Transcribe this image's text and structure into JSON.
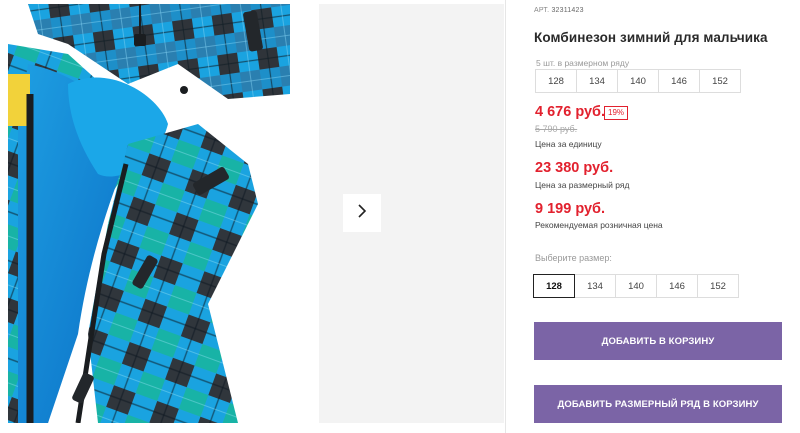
{
  "gallery": {
    "next_icon": "chevron-right-icon"
  },
  "product": {
    "art_label": "АРТ.",
    "art_number": "32311423",
    "title": "Комбинезон зимний для мальчика"
  },
  "set": {
    "note": "5 шт. в размерном ряду",
    "sizes": [
      "128",
      "134",
      "140",
      "146",
      "152"
    ]
  },
  "pricing": {
    "unit_price": "4 676 руб.",
    "discount": "19%",
    "old_price": "5 790 руб.",
    "unit_label": "Цена за единицу",
    "set_price": "23 380 руб.",
    "set_label": "Цена за размерный ряд",
    "rrp_price": "9 199 руб.",
    "rrp_label": "Рекомендуемая розничная цена"
  },
  "size_picker": {
    "label": "Выберите размер:",
    "options": [
      "128",
      "134",
      "140",
      "146",
      "152"
    ],
    "selected": "128"
  },
  "actions": {
    "add_to_cart": "ДОБАВИТЬ В КОРЗИНУ",
    "add_set_to_cart": "ДОБАВИТЬ РАЗМЕРНЫЙ РЯД В КОРЗИНУ"
  },
  "colors": {
    "accent_price": "#e2212e",
    "button_purple": "#7b64a6",
    "jacket_blue": "#1aa3e0",
    "jacket_dark": "#2f343a",
    "jacket_teal": "#18b3a6"
  }
}
